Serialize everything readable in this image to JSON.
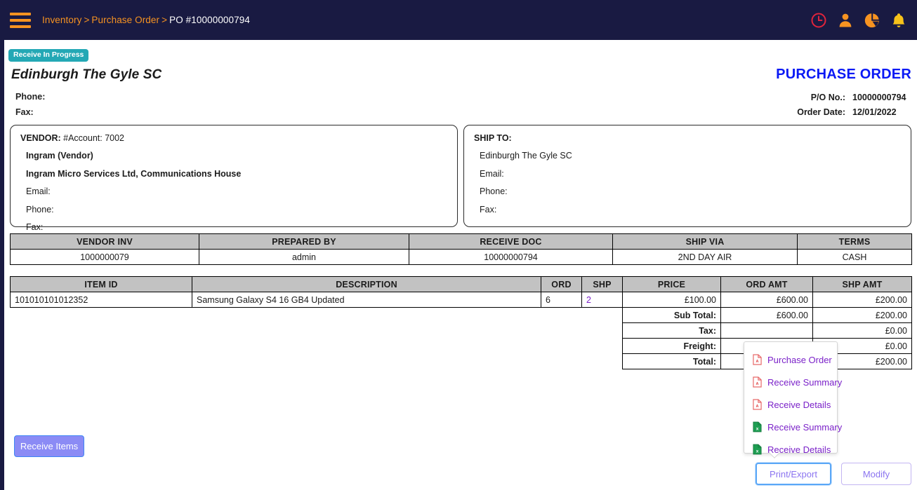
{
  "topbar": {
    "menu_icon": "hamburger-menu-icon",
    "breadcrumb": {
      "item1": "Inventory",
      "sep1": ">",
      "item2": "Purchase Order",
      "sep2": ">",
      "current": "PO #10000000794"
    },
    "icons": [
      {
        "name": "clock-icon",
        "color": "#e0243c"
      },
      {
        "name": "user-icon",
        "color": "#f79321"
      },
      {
        "name": "pie-chart-icon",
        "color": "#f79321"
      },
      {
        "name": "bell-icon",
        "color": "#f7c21a"
      }
    ]
  },
  "header": {
    "status_badge": "Receive In Progress",
    "site_name": "Edinburgh The Gyle SC",
    "phone_label": "Phone:",
    "fax_label": "Fax:",
    "doc_title": "PURCHASE ORDER",
    "po_no_label": "P/O No.:",
    "po_no_value": "10000000794",
    "order_date_label": "Order Date:",
    "order_date_value": "12/01/2022"
  },
  "vendor": {
    "title": "VENDOR:",
    "account": "#Account: 7002",
    "name": "Ingram (Vendor)",
    "address": "Ingram Micro Services Ltd, Communications House",
    "email_label": "Email:",
    "phone_label": "Phone:",
    "fax_label": "Fax:"
  },
  "shipto": {
    "title": "SHIP TO:",
    "name": "Edinburgh The Gyle SC",
    "email_label": "Email:",
    "phone_label": "Phone:",
    "fax_label": "Fax:"
  },
  "meta_table": {
    "headers": [
      "VENDOR INV",
      "PREPARED BY",
      "RECEIVE DOC",
      "SHIP VIA",
      "TERMS"
    ],
    "values": [
      "1000000079",
      "admin",
      "10000000794",
      "2ND DAY AIR",
      "CASH"
    ]
  },
  "items_table": {
    "headers": [
      "ITEM ID",
      "DESCRIPTION",
      "ORD",
      "SHP",
      "PRICE",
      "ORD AMT",
      "SHP AMT"
    ],
    "rows": [
      {
        "item_id": "101010101012352",
        "description": "Samsung Galaxy S4 16 GB4 Updated",
        "ord": "6",
        "shp": "2",
        "price": "£100.00",
        "ord_amt": "£600.00",
        "shp_amt": "£200.00"
      }
    ],
    "totals": [
      {
        "label": "Sub Total:",
        "ord_amt": "£600.00",
        "shp_amt": "£200.00"
      },
      {
        "label": "Tax:",
        "ord_amt": "",
        "shp_amt": "£0.00"
      },
      {
        "label": "Freight:",
        "ord_amt": "",
        "shp_amt": "£0.00"
      },
      {
        "label": "Total:",
        "ord_amt": "",
        "shp_amt": "£200.00"
      }
    ]
  },
  "dropdown": {
    "items": [
      {
        "label": "Purchase Order",
        "icon": "pdf-file-icon",
        "format": "pdf"
      },
      {
        "label": "Receive Summary",
        "icon": "pdf-file-icon",
        "format": "pdf"
      },
      {
        "label": "Receive Details",
        "icon": "pdf-file-icon",
        "format": "pdf"
      },
      {
        "label": "Receive Summary",
        "icon": "excel-file-icon",
        "format": "excel"
      },
      {
        "label": "Receive Details",
        "icon": "excel-file-icon",
        "format": "excel"
      }
    ]
  },
  "buttons": {
    "receive_items": "Receive Items",
    "print_export": "Print/Export",
    "modify": "Modify"
  },
  "colors": {
    "navy": "#191a42",
    "orange": "#f79321",
    "teal_badge": "#24a8b5",
    "blue_title": "#0a19f5",
    "purple_link": "#7b22c9",
    "table_header_gray": "#c2c2c2"
  }
}
